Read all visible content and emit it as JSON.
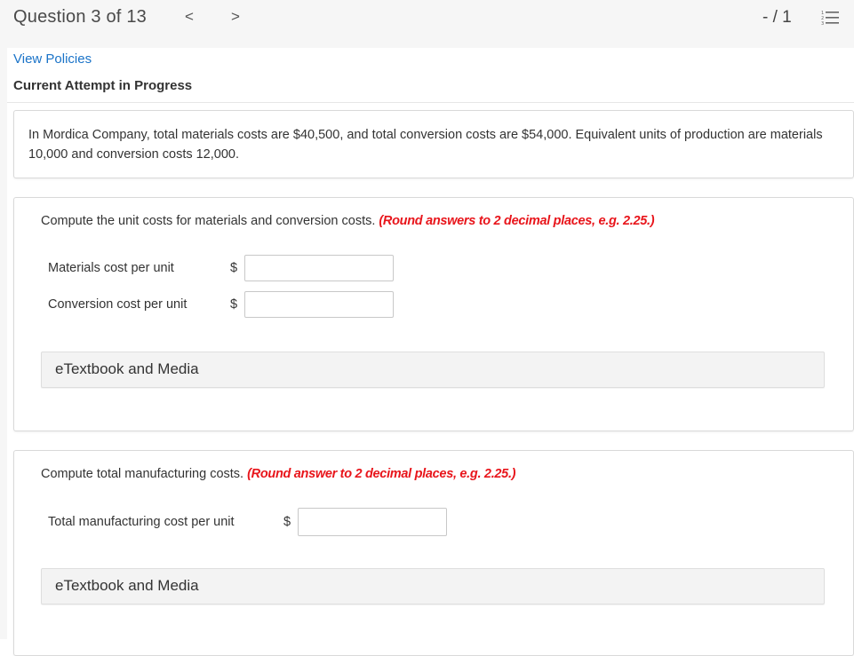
{
  "header": {
    "question_label": "Question 3 of 13",
    "prev_icon": "chevron-left-icon",
    "prev_glyph": "<",
    "next_icon": "chevron-right-icon",
    "next_glyph": ">",
    "score": "- / 1",
    "menu_icon": "numbered-list-icon"
  },
  "links": {
    "view_policies": "View Policies"
  },
  "status": {
    "attempt": "Current Attempt in Progress"
  },
  "intro": {
    "text": "In Mordica Company, total materials costs are $40,500, and total conversion costs are $54,000. Equivalent units of production are materials 10,000 and conversion costs 12,000."
  },
  "part_a": {
    "prompt": "Compute the unit costs for materials and conversion costs.",
    "hint": "(Round answers to 2 decimal places, e.g. 2.25.)",
    "rows": [
      {
        "label": "Materials cost per unit",
        "currency": "$",
        "value": "",
        "placeholder": ""
      },
      {
        "label": "Conversion cost per unit",
        "currency": "$",
        "value": "",
        "placeholder": ""
      }
    ],
    "etext_label": "eTextbook and Media"
  },
  "part_b": {
    "prompt": "Compute total manufacturing costs.",
    "hint": "(Round answer to 2 decimal places, e.g. 2.25.)",
    "rows": [
      {
        "label": "Total manufacturing cost per unit",
        "currency": "$",
        "value": "",
        "placeholder": ""
      }
    ],
    "etext_label": "eTextbook and Media"
  },
  "colors": {
    "link": "#1a73c8",
    "hint": "#e8151b",
    "topbar": "#f6f6f6"
  }
}
